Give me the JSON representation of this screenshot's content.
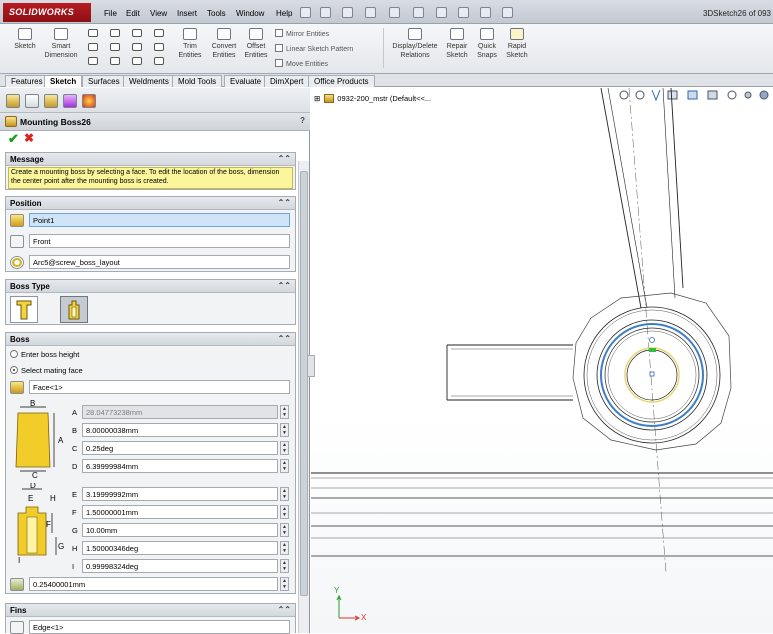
{
  "app": {
    "logo": "SOLIDWORKS",
    "document_title": "3DSketch26 of 093",
    "menu": [
      "File",
      "Edit",
      "View",
      "Insert",
      "Tools",
      "Window",
      "Help"
    ]
  },
  "ribbon": {
    "sketch": "Sketch",
    "smart_dimension": [
      "Smart",
      "Dimension"
    ],
    "trim_entities": [
      "Trim",
      "Entities"
    ],
    "convert_entities": [
      "Convert",
      "Entities"
    ],
    "offset_entities": [
      "Offset",
      "Entities"
    ],
    "mirror_entities": "Mirror Entities",
    "linear_sketch_pattern": "Linear Sketch Pattern",
    "move_entities": "Move Entities",
    "display_delete_relations": [
      "Display/Delete",
      "Relations"
    ],
    "repair_sketch": [
      "Repair",
      "Sketch"
    ],
    "quick_snaps": [
      "Quick",
      "Snaps"
    ],
    "rapid_sketch": [
      "Rapid",
      "Sketch"
    ]
  },
  "tabs": [
    "Features",
    "Sketch",
    "Surfaces",
    "Weldments",
    "Mold Tools",
    "Evaluate",
    "DimXpert",
    "Office Products"
  ],
  "active_tab": "Sketch",
  "property_manager": {
    "title": "Mounting Boss26",
    "help": "?",
    "message_group": {
      "title": "Message",
      "text": "Create a mounting boss by selecting a face. To edit the location of the boss, dimension the center point after the mounting boss is created."
    },
    "position_group": {
      "title": "Position",
      "point": "Point1",
      "plane": "Front",
      "edge": "Arc5@screw_boss_layout"
    },
    "boss_type_group": {
      "title": "Boss Type"
    },
    "boss_group": {
      "title": "Boss",
      "option_height": "Enter boss height",
      "option_mating": "Select mating face",
      "face": "Face<1>",
      "A": "28.04773238mm",
      "B": "8.00000038mm",
      "C": "0.25deg",
      "D": "6.39999984mm",
      "E": "3.19999992mm",
      "F": "1.50000001mm",
      "G": "10.00mm",
      "H": "1.50000346deg",
      "I": "0.99998324deg",
      "clearance": "0.25400001mm",
      "diagram_top_labels": [
        "A",
        "B",
        "C",
        "D"
      ],
      "diagram_bottom_labels": [
        "D",
        "E",
        "H",
        "F",
        "G",
        "I"
      ]
    },
    "fins_group": {
      "title": "Fins",
      "edge": "Edge<1>"
    }
  },
  "graphics": {
    "tree_item": "0932-200_mstr  (Default<<...",
    "triad": {
      "x": "X",
      "y": "Y"
    }
  }
}
